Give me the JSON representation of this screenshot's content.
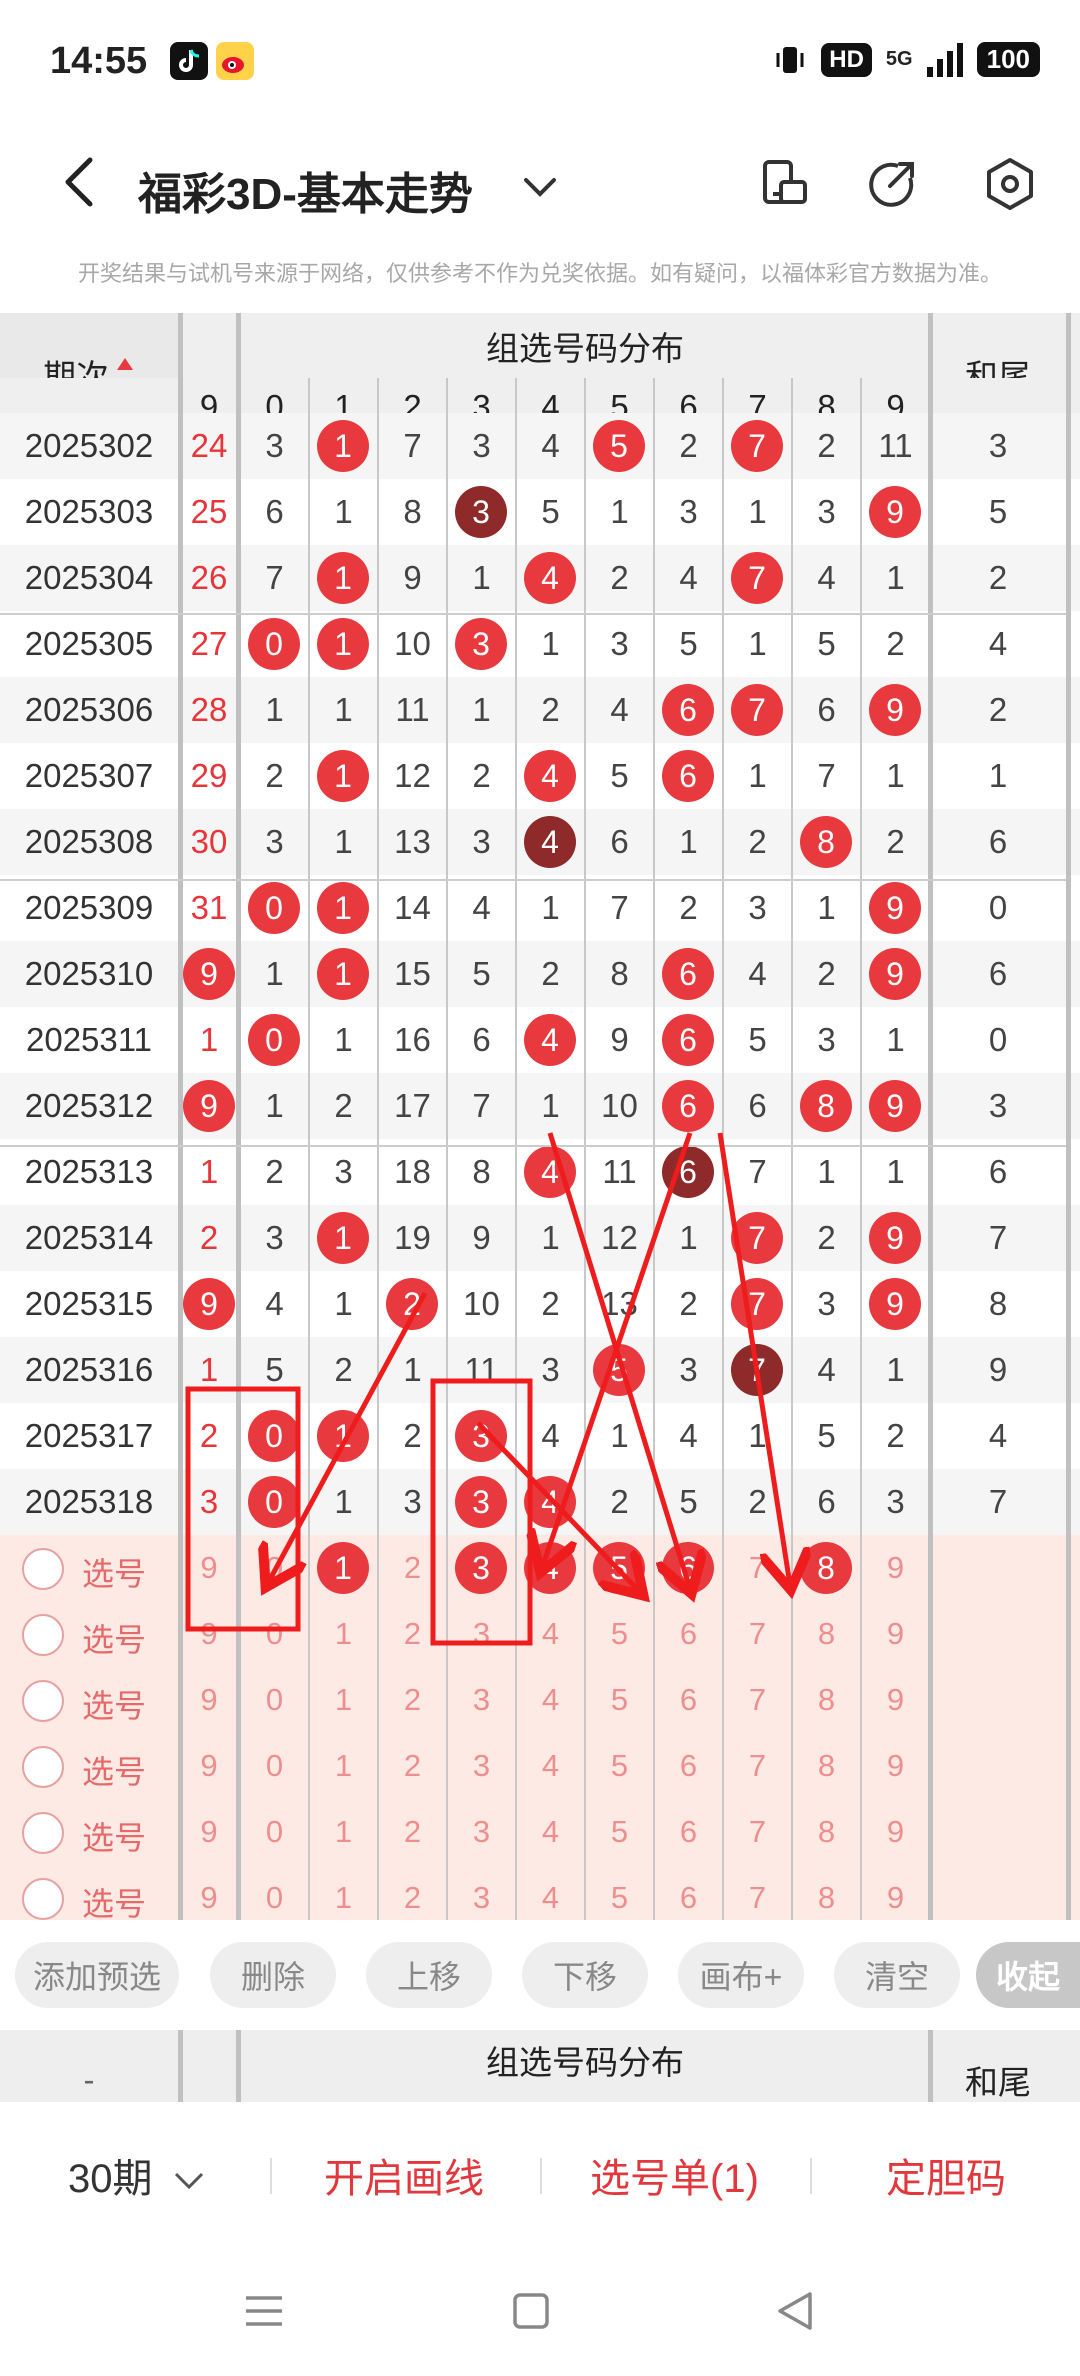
{
  "status": {
    "time": "14:55",
    "hd": "HD",
    "net": "5G",
    "battery": "100"
  },
  "header": {
    "title": "福彩3D-基本走势"
  },
  "notice": "开奖结果与试机号来源于网络，仅供参考不作为兑奖依据。如有疑问，以福体彩官方数据为准。",
  "table": {
    "period_header": "期次",
    "group_header": "组选号码分布",
    "sum_header": "和尾",
    "subheader_first": "9",
    "digits": [
      "0",
      "1",
      "2",
      "3",
      "4",
      "5",
      "6",
      "7",
      "8",
      "9"
    ],
    "rows": [
      {
        "p": "2025302",
        "s": "24",
        "d": [
          "3",
          "1",
          "7",
          "3",
          "4",
          "5",
          "2",
          "7",
          "2",
          "11"
        ],
        "t": "3"
      },
      {
        "p": "2025303",
        "s": "25",
        "d": [
          "6",
          "1",
          "8",
          "3",
          "5",
          "1",
          "3",
          "1",
          "3",
          "9"
        ],
        "t": "5"
      },
      {
        "p": "2025304",
        "s": "26",
        "d": [
          "7",
          "1",
          "9",
          "1",
          "4",
          "2",
          "4",
          "7",
          "4",
          "1"
        ],
        "t": "2"
      },
      {
        "p": "2025305",
        "s": "27",
        "d": [
          "0",
          "1",
          "10",
          "3",
          "1",
          "3",
          "5",
          "1",
          "5",
          "2"
        ],
        "t": "4"
      },
      {
        "p": "2025306",
        "s": "28",
        "d": [
          "1",
          "1",
          "11",
          "1",
          "2",
          "4",
          "6",
          "7",
          "6",
          "9"
        ],
        "t": "2"
      },
      {
        "p": "2025307",
        "s": "29",
        "d": [
          "2",
          "1",
          "12",
          "2",
          "4",
          "5",
          "6",
          "1",
          "7",
          "1"
        ],
        "t": "1"
      },
      {
        "p": "2025308",
        "s": "30",
        "d": [
          "3",
          "1",
          "13",
          "3",
          "4",
          "6",
          "1",
          "2",
          "8",
          "2"
        ],
        "t": "6"
      },
      {
        "p": "2025309",
        "s": "31",
        "d": [
          "0",
          "1",
          "14",
          "4",
          "1",
          "7",
          "2",
          "3",
          "1",
          "9"
        ],
        "t": "0"
      },
      {
        "p": "2025310",
        "s": "9",
        "d": [
          "1",
          "1",
          "15",
          "5",
          "2",
          "8",
          "6",
          "4",
          "2",
          "9"
        ],
        "t": "6"
      },
      {
        "p": "2025311",
        "s": "1",
        "d": [
          "0",
          "1",
          "16",
          "6",
          "4",
          "9",
          "6",
          "5",
          "3",
          "1"
        ],
        "t": "0"
      },
      {
        "p": "2025312",
        "s": "9",
        "d": [
          "1",
          "2",
          "17",
          "7",
          "1",
          "10",
          "6",
          "6",
          "8",
          "9"
        ],
        "t": "3"
      },
      {
        "p": "2025313",
        "s": "1",
        "d": [
          "2",
          "3",
          "18",
          "8",
          "4",
          "11",
          "6",
          "7",
          "1",
          "1"
        ],
        "t": "6"
      },
      {
        "p": "2025314",
        "s": "2",
        "d": [
          "3",
          "1",
          "19",
          "9",
          "1",
          "12",
          "1",
          "7",
          "2",
          "9"
        ],
        "t": "7"
      },
      {
        "p": "2025315",
        "s": "9",
        "d": [
          "4",
          "1",
          "2",
          "10",
          "2",
          "13",
          "2",
          "7",
          "3",
          "9"
        ],
        "t": "8"
      },
      {
        "p": "2025316",
        "s": "1",
        "d": [
          "5",
          "2",
          "1",
          "11",
          "3",
          "5",
          "3",
          "7",
          "4",
          "1"
        ],
        "t": "9"
      },
      {
        "p": "2025317",
        "s": "2",
        "d": [
          "0",
          "1",
          "2",
          "3",
          "4",
          "1",
          "4",
          "1",
          "5",
          "2"
        ],
        "t": "4"
      },
      {
        "p": "2025318",
        "s": "3",
        "d": [
          "0",
          "1",
          "3",
          "3",
          "4",
          "2",
          "5",
          "2",
          "6",
          "3"
        ],
        "t": "7"
      }
    ],
    "select_label": "选号",
    "select_first": "9",
    "select_rows": 6
  },
  "toolbar": {
    "add": "添加预选",
    "delete": "删除",
    "up": "上移",
    "down": "下移",
    "canvas": "画布+",
    "clear": "清空",
    "collapse": "收起"
  },
  "section2": {
    "dash": "-",
    "group": "组选号码分布",
    "sum": "和尾"
  },
  "bottom": {
    "periods": "30期",
    "draw_line": "开启画线",
    "pick_list": "选号单(1)",
    "lock": "定胆码"
  },
  "colors": {
    "red": "#e83a3e",
    "dark": "#8e2a2a",
    "sum_red": "#e8353a",
    "select_bg": "#fdeae5",
    "annotation": "#ee1c1c"
  }
}
